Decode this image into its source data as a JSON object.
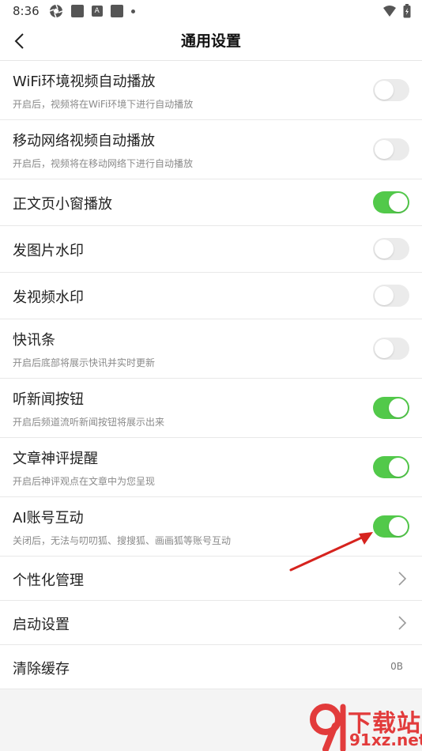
{
  "status": {
    "time": "8:36",
    "app_icon_letter": "A"
  },
  "nav": {
    "title": "通用设置"
  },
  "settings": [
    {
      "title": "WiFi环境视频自动播放",
      "subtitle": "开启后，视频将在WiFi环境下进行自动播放",
      "enabled": false
    },
    {
      "title": "移动网络视频自动播放",
      "subtitle": "开启后，视频将在移动网络下进行自动播放",
      "enabled": false
    },
    {
      "title": "正文页小窗播放",
      "enabled": true
    },
    {
      "title": "发图片水印",
      "enabled": false
    },
    {
      "title": "发视频水印",
      "enabled": false
    },
    {
      "title": "快讯条",
      "subtitle": "开启后底部将展示快讯并实时更新",
      "enabled": false
    },
    {
      "title": "听新闻按钮",
      "subtitle": "开启后频道流听新闻按钮将展示出来",
      "enabled": true
    },
    {
      "title": "文章神评提醒",
      "subtitle": "开启后神评观点在文章中为您呈现",
      "enabled": true
    },
    {
      "title": "AI账号互动",
      "subtitle": "关闭后，无法与叨叨狐、搜搜狐、画画狐等账号互动",
      "enabled": true
    }
  ],
  "nav_items": [
    {
      "title": "个性化管理"
    },
    {
      "title": "启动设置"
    }
  ],
  "cache": {
    "title": "清除缓存",
    "value": "0B"
  },
  "watermark": {
    "line1": "下载站",
    "line2": "91xz.net"
  },
  "colors": {
    "toggle_on": "#52c94a",
    "toggle_off": "#ebebeb",
    "annotation_arrow": "#d6231e"
  }
}
